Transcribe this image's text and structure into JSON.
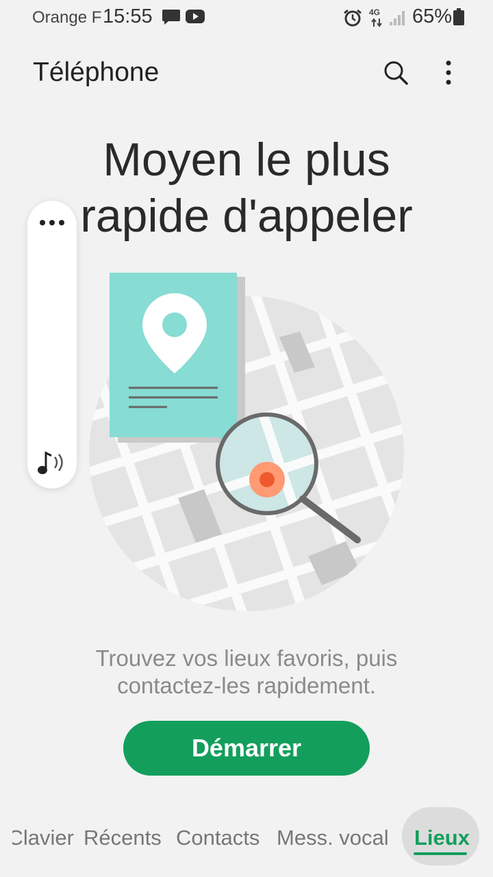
{
  "status_bar": {
    "carrier": "Orange F",
    "time": "15:55",
    "network_type": "4G",
    "battery": "65%",
    "icons": [
      "message-icon",
      "youtube-icon",
      "alarm-icon",
      "signal-icon",
      "battery-icon"
    ]
  },
  "app_bar": {
    "title": "Téléphone",
    "actions": [
      "search-icon",
      "more-vert-icon"
    ]
  },
  "main": {
    "headline": "Moyen le plus rapide d'appeler",
    "description": "Trouvez vos lieux favoris, puis contactez-les rapidement.",
    "cta_label": "Démarrer",
    "accent_color": "#149e5c"
  },
  "edge_panel": {
    "icons": [
      "more-horiz-icon",
      "music-sound-icon"
    ]
  },
  "tabs": [
    {
      "label": "Clavier",
      "active": false
    },
    {
      "label": "Récents",
      "active": false
    },
    {
      "label": "Contacts",
      "active": false
    },
    {
      "label": "Mess. vocal",
      "active": false
    },
    {
      "label": "Lieux",
      "active": true
    }
  ]
}
